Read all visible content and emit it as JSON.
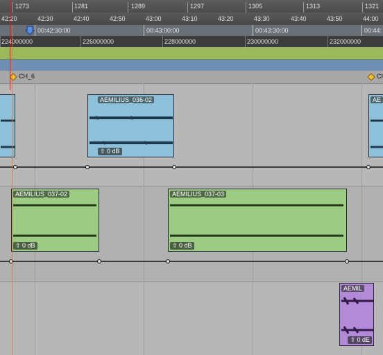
{
  "bar_ruler": {
    "labels": [
      "1273",
      "1281",
      "1289",
      "1297",
      "1305",
      "1313",
      "1321"
    ]
  },
  "timecode_ruler": {
    "labels": [
      "42:20",
      "42:30",
      "42:40",
      "42:50",
      "43:00",
      "43:10",
      "43:20",
      "43:30",
      "43:40",
      "43:50",
      "44:00"
    ]
  },
  "time_ruler": {
    "labels": [
      "00:42:30:00",
      "00:43:00:00",
      "00:43:30:00",
      "00:44:"
    ]
  },
  "sample_ruler": {
    "labels": [
      "224000000",
      "226000000",
      "228000000",
      "230000000",
      "232000000"
    ]
  },
  "markers": [
    {
      "label": "CH_6"
    },
    {
      "label": "CH"
    }
  ],
  "clips": {
    "track1": [
      {
        "name": "",
        "gain": ""
      },
      {
        "name": "AEMILIUS_036-02",
        "gain": "0 dB"
      },
      {
        "name": "AE",
        "gain": ""
      }
    ],
    "track2": [
      {
        "name": "AEMILIUS_037-02",
        "gain": "0 dB"
      },
      {
        "name": "AEMILIUS_037-03",
        "gain": "0 dB"
      }
    ],
    "track3": [
      {
        "name": "AEMIL",
        "gain": "0 dE"
      }
    ]
  },
  "colors": {
    "clip_blue": "#8fc0da",
    "clip_green": "#9ccb83",
    "clip_purple": "#b38ad8",
    "playhead": "#e0762e",
    "marker": "#f5c034"
  }
}
